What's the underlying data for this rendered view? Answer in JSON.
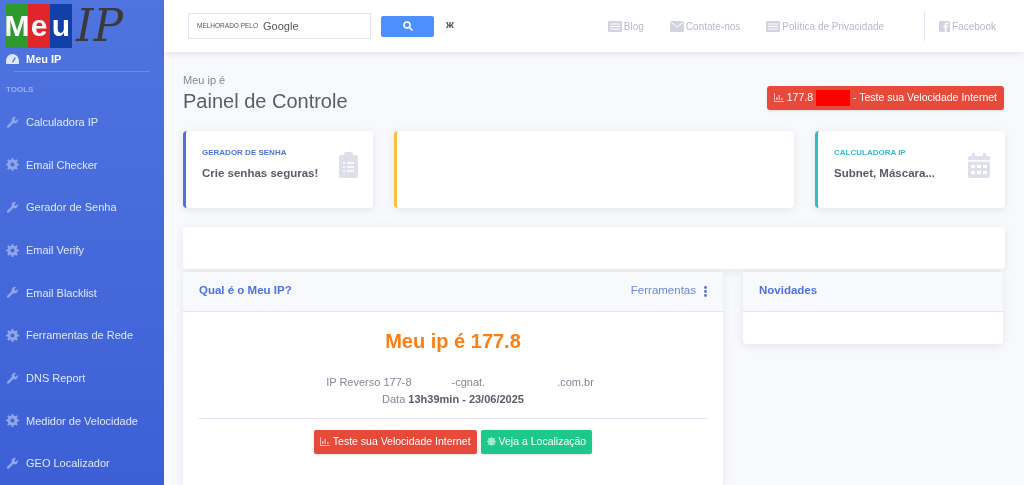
{
  "logo": {
    "tiles": [
      {
        "letter": "M",
        "color": "#2e9a2e"
      },
      {
        "letter": "e",
        "color": "#e0262b"
      },
      {
        "letter": "u",
        "color": "#1040a8"
      }
    ],
    "suffix": "IP"
  },
  "sidebar": {
    "home": "Meu IP",
    "section": "TOOLS",
    "items": [
      {
        "label": "Calculadora IP",
        "kind": "wrench"
      },
      {
        "label": "Email Checker",
        "kind": "gear"
      },
      {
        "label": "Gerador de Senha",
        "kind": "wrench"
      },
      {
        "label": "Email Verify",
        "kind": "gear"
      },
      {
        "label": "Email Blacklist",
        "kind": "wrench"
      },
      {
        "label": "Ferramentas de Rede",
        "kind": "gear"
      },
      {
        "label": "DNS Report",
        "kind": "wrench"
      },
      {
        "label": "Medidor de Velocidade",
        "kind": "gear"
      },
      {
        "label": "GEO Localizador",
        "kind": "wrench"
      }
    ]
  },
  "topbar": {
    "search": {
      "prefix": "MELHORADO PELO",
      "brand": "Google"
    },
    "clear": "ж",
    "links": [
      {
        "label": "Blog",
        "kind": "list"
      },
      {
        "label": "Contate-nos",
        "kind": "mail"
      },
      {
        "label": "Política de Privacidade",
        "kind": "list"
      },
      {
        "label": "Facebook",
        "kind": "facebook"
      }
    ]
  },
  "header": {
    "subtitle": "Meu ip é",
    "title": "Painel de Controle",
    "button": {
      "ip": "177.8",
      "label": "- Teste sua Velocidade Internet"
    }
  },
  "cards": [
    {
      "kind": "stat",
      "title": "GERADOR DE SENHA",
      "text": "Crie senhas seguras!",
      "color": "#4e73df"
    },
    {
      "kind": "empty",
      "color": "#f6c23e"
    },
    {
      "kind": "stat",
      "title": "CALCULADORA IP",
      "text": "Subnet, Máscara...",
      "color": "#36b9cc"
    }
  ],
  "ip_panel": {
    "title": "Qual é o Meu IP?",
    "menu": "Ferramentas",
    "headline": "Meu ip é 177.8",
    "reverse": [
      "IP Reverso 177-8",
      "-cgnat.",
      ".com.br"
    ],
    "date_label": "Data",
    "date_value": "13h39min - 23/06/2025",
    "buttons": [
      {
        "label": "Teste sua Velocidade Internet",
        "kind": "danger"
      },
      {
        "label": "Veja a Localização",
        "kind": "success"
      }
    ]
  },
  "news_panel": {
    "title": "Novidades"
  }
}
